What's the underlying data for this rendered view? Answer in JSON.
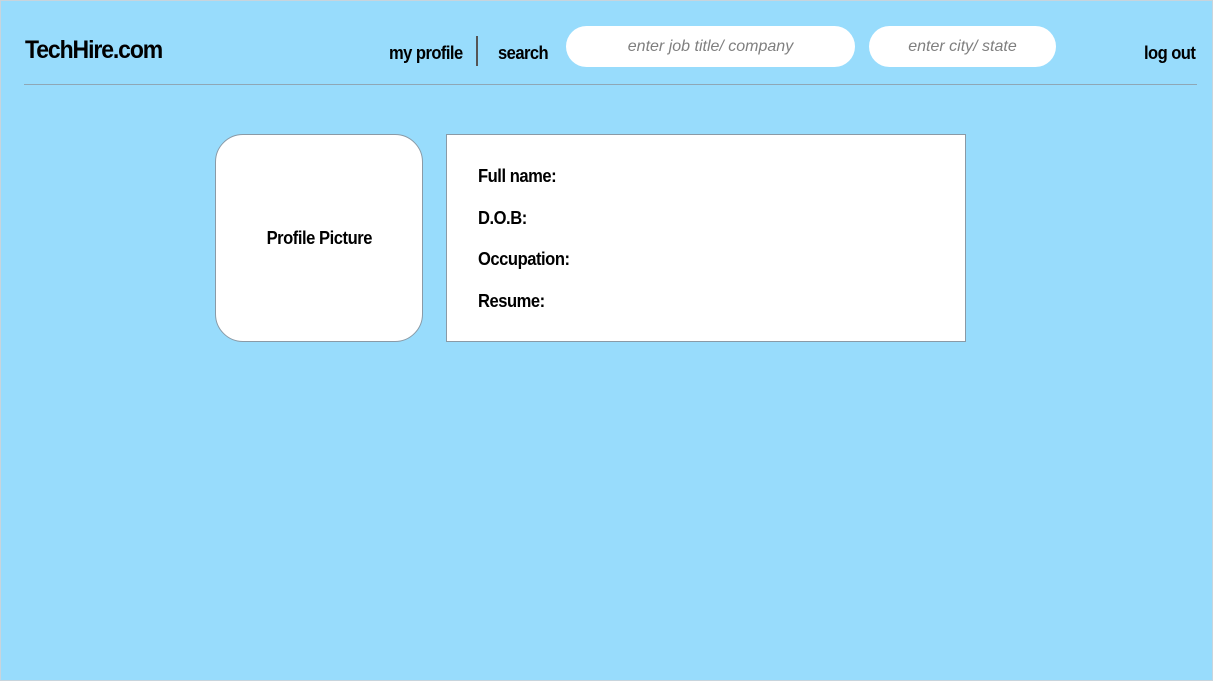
{
  "header": {
    "logo": "TechHire.com",
    "nav": {
      "my_profile": "my profile",
      "search": "search",
      "log_out": "log out"
    },
    "search": {
      "job_placeholder": "enter job title/ company",
      "location_placeholder": "enter city/ state"
    }
  },
  "profile": {
    "picture_label": "Profile Picture",
    "fields": {
      "full_name": "Full name:",
      "dob": "D.O.B:",
      "occupation": "Occupation:",
      "resume": "Resume:"
    }
  },
  "colors": {
    "background": "#98dcfc",
    "card": "#ffffff",
    "text": "#000000",
    "placeholder": "#7f7f7f"
  }
}
